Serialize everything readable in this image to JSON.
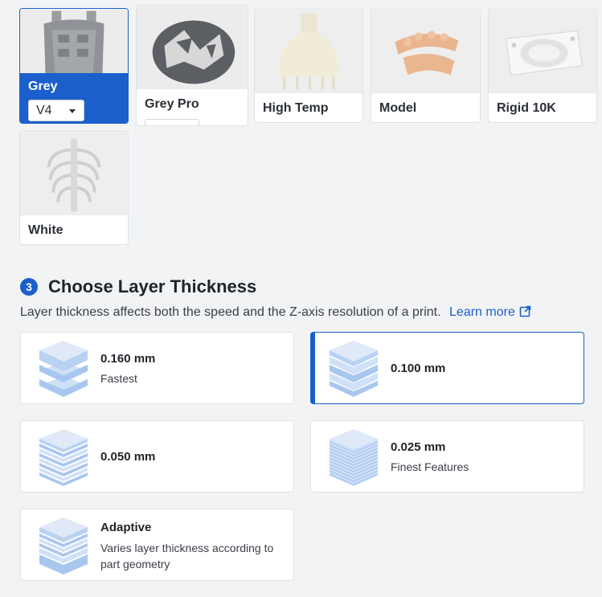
{
  "materials": [
    {
      "name": "Grey",
      "selected": true,
      "version": "V4"
    },
    {
      "name": "Grey Pro",
      "selected": false
    },
    {
      "name": "High Temp",
      "selected": false
    },
    {
      "name": "Model",
      "selected": false
    },
    {
      "name": "Rigid 10K",
      "selected": false
    },
    {
      "name": "White",
      "selected": false
    }
  ],
  "layer_section": {
    "step": "3",
    "title": "Choose Layer Thickness",
    "description": "Layer thickness affects both the speed and the Z-axis resolution of a print.",
    "learn_more": "Learn more"
  },
  "layer_options": [
    {
      "title": "0.160 mm",
      "subtitle": "Fastest",
      "selected": false
    },
    {
      "title": "0.100 mm",
      "subtitle": "",
      "selected": true
    },
    {
      "title": "0.050 mm",
      "subtitle": "",
      "selected": false
    },
    {
      "title": "0.025 mm",
      "subtitle": "Finest Features",
      "selected": false
    },
    {
      "title": "Adaptive",
      "subtitle": "Varies layer thickness according to part geometry",
      "selected": false
    }
  ],
  "colors": {
    "accent": "#1a5fcc",
    "layer_icon_light": "#cfe0f7",
    "layer_icon_dark": "#a9c7ee"
  }
}
